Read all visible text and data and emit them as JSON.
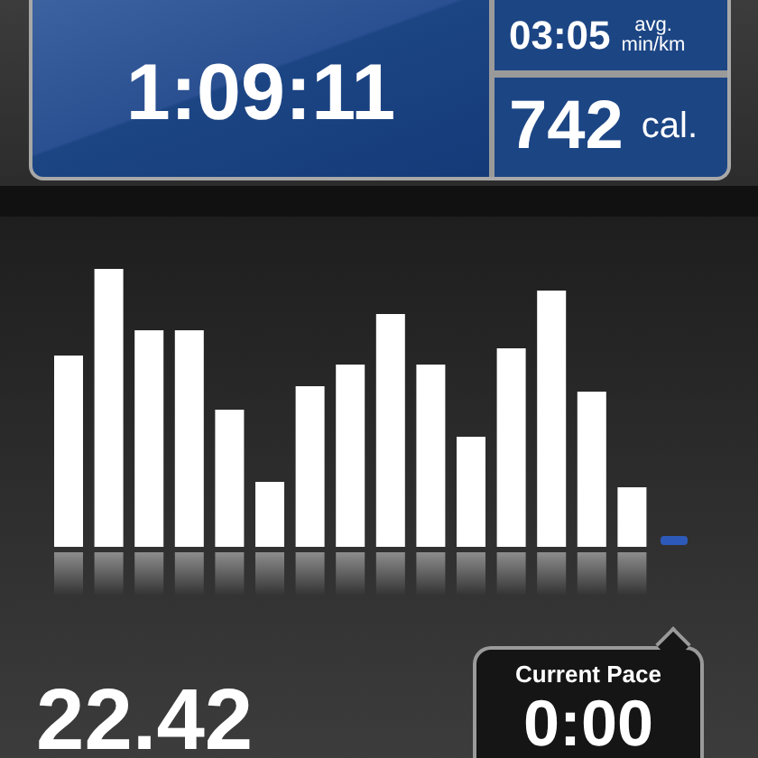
{
  "workout": {
    "duration": "1:09:11",
    "avg_pace": {
      "value": "03:05",
      "label": "avg.",
      "unit": "min/km"
    },
    "calories": {
      "value": "742",
      "unit": "cal."
    }
  },
  "distance": "22.42",
  "current_pace": {
    "label": "Current Pace",
    "value": "0:00"
  }
}
